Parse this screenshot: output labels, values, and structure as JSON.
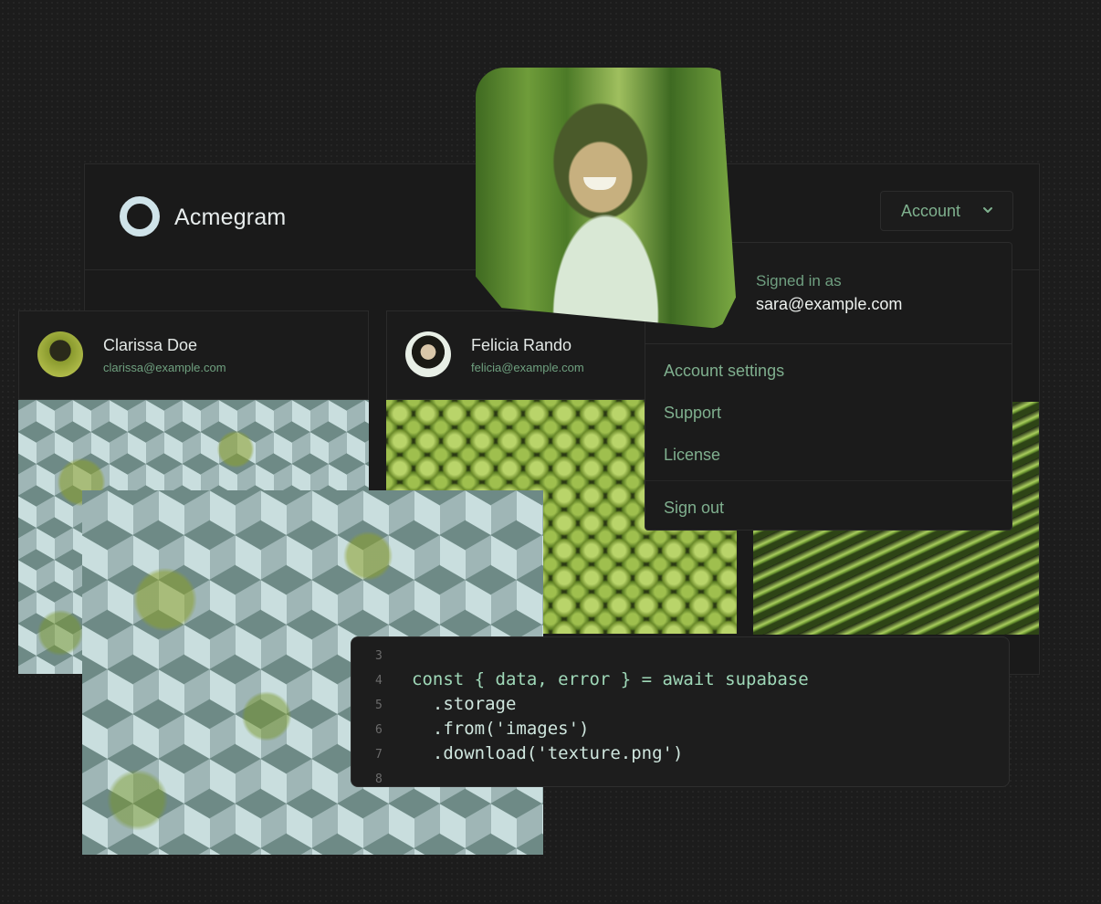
{
  "app": {
    "title": "Acmegram",
    "account_button_label": "Account"
  },
  "users": [
    {
      "name": "Clarissa Doe",
      "email": "clarissa@example.com"
    },
    {
      "name": "Felicia Rando",
      "email": "felicia@example.com"
    }
  ],
  "account_menu": {
    "signed_in_label": "Signed in as",
    "signed_in_email": "sara@example.com",
    "items": [
      "Account settings",
      "Support",
      "License",
      "Sign out"
    ]
  },
  "code": {
    "lines": [
      {
        "num": "3",
        "text": ""
      },
      {
        "num": "4",
        "text": "const { data, error } = await supabase"
      },
      {
        "num": "5",
        "text": "  .storage"
      },
      {
        "num": "6",
        "text": "  .from('images')"
      },
      {
        "num": "7",
        "text": "  .download('texture.png')"
      },
      {
        "num": "8",
        "text": ""
      }
    ]
  },
  "colors": {
    "background": "#1c1c1c",
    "accent_green": "#7faf8e",
    "logo": "#cfe3e9"
  },
  "icons": [
    "logo-ring-icon",
    "chevron-down-icon"
  ]
}
